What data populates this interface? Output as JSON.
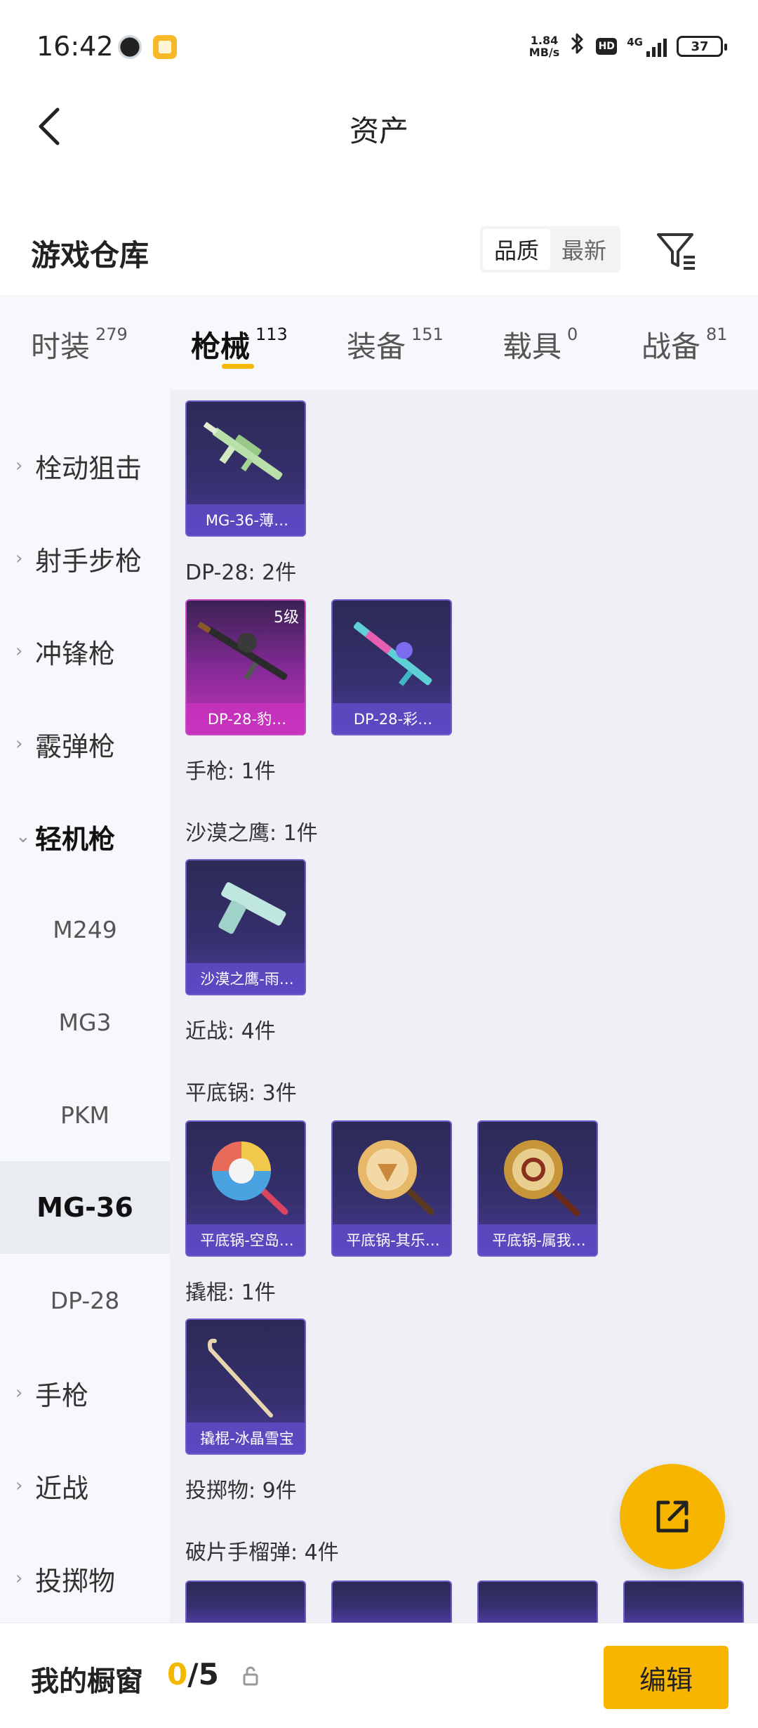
{
  "status_bar": {
    "time": "16:42",
    "net_speed_value": "1.84",
    "net_speed_unit": "MB/s",
    "hd_label": "HD",
    "network_type": "4G",
    "battery": "37",
    "icons": [
      "clock-app-icon",
      "notes-app-icon",
      "bluetooth-icon",
      "hd-icon",
      "signal-icon",
      "battery-icon"
    ]
  },
  "header": {
    "title": "资产"
  },
  "section": {
    "title": "游戏仓库",
    "sort_options": [
      "品质",
      "最新"
    ],
    "active_sort": "品质"
  },
  "tabs": [
    {
      "label": "时装",
      "count": "279"
    },
    {
      "label": "枪械",
      "count": "113"
    },
    {
      "label": "装备",
      "count": "151"
    },
    {
      "label": "载具",
      "count": "0"
    },
    {
      "label": "战备",
      "count": "81"
    }
  ],
  "active_tab": "枪械",
  "sidebar": {
    "items": [
      {
        "label": "栓动狙击"
      },
      {
        "label": "射手步枪"
      },
      {
        "label": "冲锋枪"
      },
      {
        "label": "霰弹枪"
      },
      {
        "label": "轻机枪"
      },
      {
        "label": "手枪"
      },
      {
        "label": "近战"
      },
      {
        "label": "投掷物"
      }
    ],
    "sub_items": [
      "M249",
      "MG3",
      "PKM",
      "MG-36",
      "DP-28"
    ],
    "selected_sub": "MG-36"
  },
  "content": {
    "groups": [
      {
        "label": "DP-28: 2件"
      },
      {
        "label": "手枪: 1件"
      },
      {
        "label": "沙漠之鹰: 1件"
      },
      {
        "label": "近战: 4件"
      },
      {
        "label": "平底锅: 3件"
      },
      {
        "label": "撬棍: 1件"
      },
      {
        "label": "投掷物: 9件"
      },
      {
        "label": "破片手榴弹: 4件"
      }
    ],
    "cards": [
      {
        "name": "MG-36-薄…"
      },
      {
        "name": "DP-28-豹…",
        "level": "5级"
      },
      {
        "name": "DP-28-彩…"
      },
      {
        "name": "沙漠之鹰-雨…"
      },
      {
        "name": "平底锅-空岛…"
      },
      {
        "name": "平底锅-其乐…"
      },
      {
        "name": "平底锅-属我…"
      },
      {
        "name": "撬棍-冰晶雪宝"
      }
    ]
  },
  "bottom_bar": {
    "label": "我的橱窗",
    "current": "0",
    "total": "/5",
    "edit_label": "编辑"
  },
  "colors": {
    "accent": "#f7b500",
    "card_purple": "#36306e",
    "card_pink": "#c238b7",
    "sidebar_bg": "#f6f8fb",
    "content_bg": "#eef0f5"
  }
}
